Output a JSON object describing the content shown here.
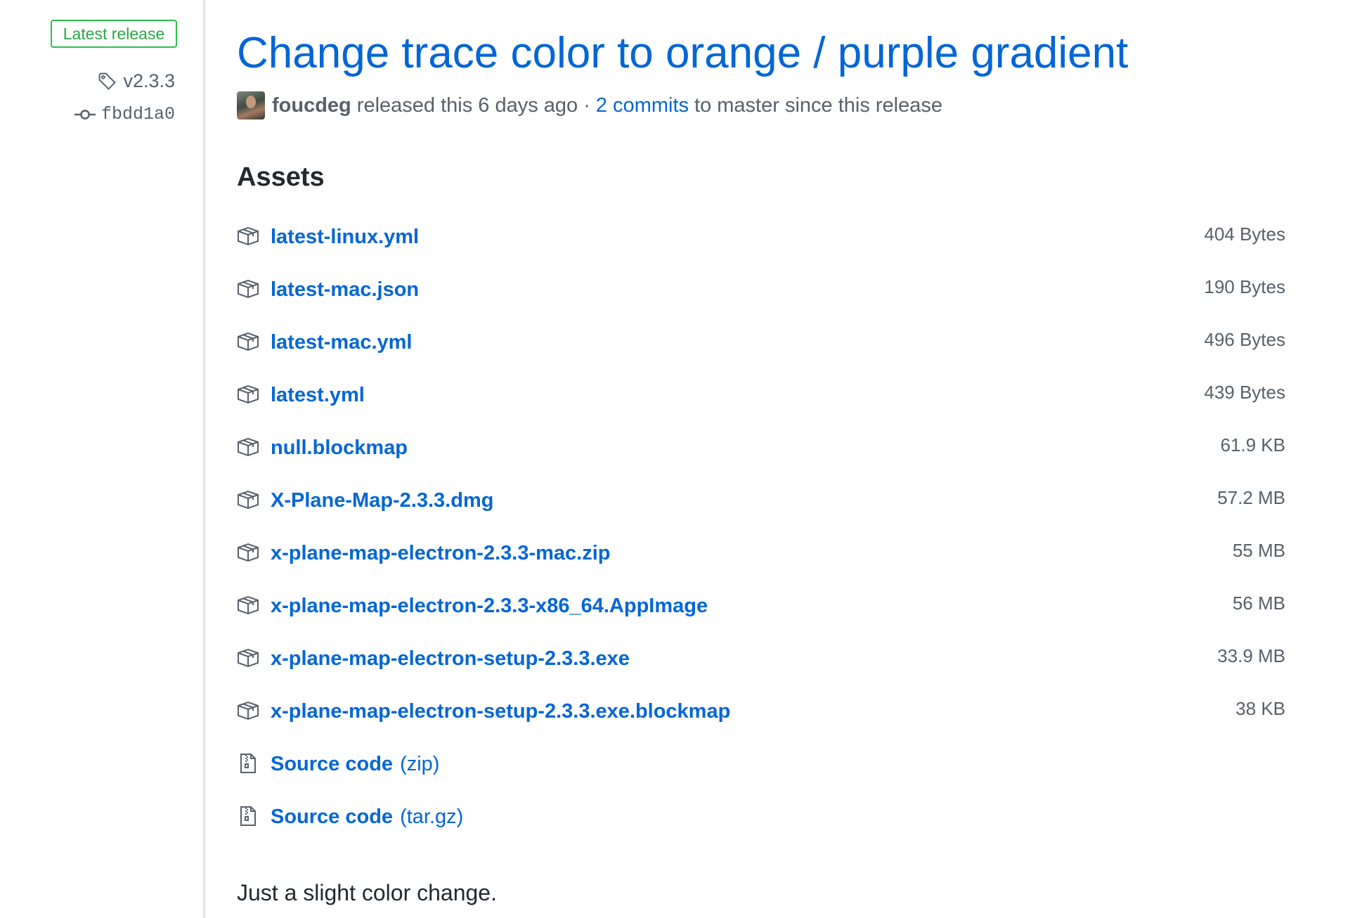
{
  "sidebar": {
    "label": "Latest release",
    "tag": "v2.3.3",
    "commit": "fbdd1a0",
    "icons": {
      "tag": "tag-icon",
      "commit": "git-commit-icon"
    }
  },
  "release": {
    "title": "Change trace color to orange / purple gradient",
    "author": "foucdeg",
    "released_text": "released this 6 days ago ·",
    "commits_link": "2 commits",
    "commits_suffix": "to master since this release"
  },
  "assets": {
    "heading": "Assets",
    "items": [
      {
        "name": "latest-linux.yml",
        "size": "404 Bytes",
        "icon": "package-icon"
      },
      {
        "name": "latest-mac.json",
        "size": "190 Bytes",
        "icon": "package-icon"
      },
      {
        "name": "latest-mac.yml",
        "size": "496 Bytes",
        "icon": "package-icon"
      },
      {
        "name": "latest.yml",
        "size": "439 Bytes",
        "icon": "package-icon"
      },
      {
        "name": "null.blockmap",
        "size": "61.9 KB",
        "icon": "package-icon"
      },
      {
        "name": "X-Plane-Map-2.3.3.dmg",
        "size": "57.2 MB",
        "icon": "package-icon"
      },
      {
        "name": "x-plane-map-electron-2.3.3-mac.zip",
        "size": "55 MB",
        "icon": "package-icon"
      },
      {
        "name": "x-plane-map-electron-2.3.3-x86_64.AppImage",
        "size": "56 MB",
        "icon": "package-icon"
      },
      {
        "name": "x-plane-map-electron-setup-2.3.3.exe",
        "size": "33.9 MB",
        "icon": "package-icon"
      },
      {
        "name": "x-plane-map-electron-setup-2.3.3.exe.blockmap",
        "size": "38 KB",
        "icon": "package-icon"
      },
      {
        "name": "Source code",
        "suffix": "(zip)",
        "icon": "file-zip-icon"
      },
      {
        "name": "Source code",
        "suffix": "(tar.gz)",
        "icon": "file-zip-icon"
      }
    ]
  },
  "notes": "Just a slight color change.",
  "colors": {
    "link": "#0366d6",
    "text": "#24292e",
    "muted": "#586069",
    "latest_green": "#28a745",
    "border": "#e1e4e8"
  }
}
